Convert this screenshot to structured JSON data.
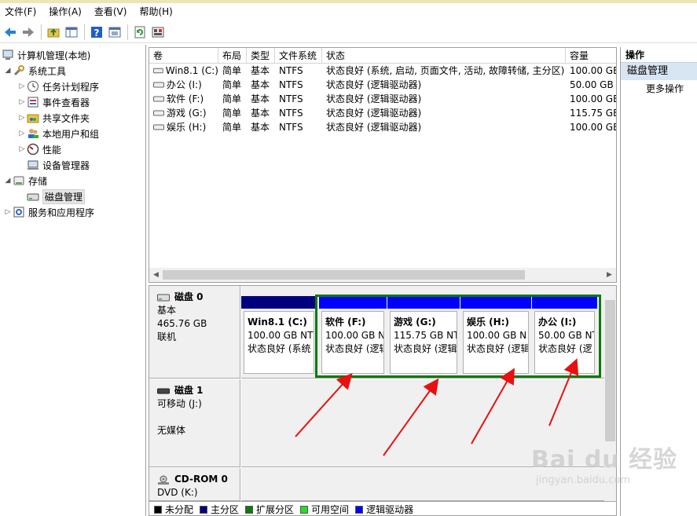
{
  "menu": [
    "文件(F)",
    "操作(A)",
    "查看(V)",
    "帮助(H)"
  ],
  "tree": {
    "root": "计算机管理(本地)",
    "system_tools": "系统工具",
    "task_scheduler": "任务计划程序",
    "event_viewer": "事件查看器",
    "shared_folders": "共享文件夹",
    "local_users": "本地用户和组",
    "performance": "性能",
    "device_manager": "设备管理器",
    "storage": "存储",
    "disk_management": "磁盘管理",
    "services_apps": "服务和应用程序"
  },
  "volume_table": {
    "columns": [
      "卷",
      "布局",
      "类型",
      "文件系统",
      "状态",
      "容量"
    ],
    "rows": [
      {
        "vol": "Win8.1 (C:)",
        "layout": "简单",
        "type": "基本",
        "fs": "NTFS",
        "status": "状态良好 (系统, 启动, 页面文件, 活动, 故障转储, 主分区)",
        "capacity": "100.00 GB"
      },
      {
        "vol": "办公 (I:)",
        "layout": "简单",
        "type": "基本",
        "fs": "NTFS",
        "status": "状态良好 (逻辑驱动器)",
        "capacity": "50.00 GB"
      },
      {
        "vol": "软件 (F:)",
        "layout": "简单",
        "type": "基本",
        "fs": "NTFS",
        "status": "状态良好 (逻辑驱动器)",
        "capacity": "100.00 GB"
      },
      {
        "vol": "游戏 (G:)",
        "layout": "简单",
        "type": "基本",
        "fs": "NTFS",
        "status": "状态良好 (逻辑驱动器)",
        "capacity": "115.75 GB"
      },
      {
        "vol": "娱乐 (H:)",
        "layout": "简单",
        "type": "基本",
        "fs": "NTFS",
        "status": "状态良好 (逻辑驱动器)",
        "capacity": "100.00 GB"
      }
    ]
  },
  "disks": [
    {
      "name": "磁盘 0",
      "kind": "基本",
      "size": "465.76 GB",
      "state": "联机",
      "partitions": [
        {
          "name": "Win8.1  (C:)",
          "size": "100.00 GB NT",
          "status": "状态良好 (系统"
        },
        {
          "name": "软件  (F:)",
          "size": "100.00 GB N",
          "status": "状态良好 (逻辑"
        },
        {
          "name": "游戏  (G:)",
          "size": "115.75 GB NT",
          "status": "状态良好 (逻辑"
        },
        {
          "name": "娱乐  (H:)",
          "size": "100.00 GB N",
          "status": "状态良好 (逻辑"
        },
        {
          "name": "办公  (I:)",
          "size": "50.00 GB NT",
          "status": "状态良好 (逻"
        }
      ]
    },
    {
      "name": "磁盘 1",
      "kind": "可移动 (J:)",
      "state": "无媒体"
    },
    {
      "name": "CD-ROM 0",
      "kind": "DVD (K:)"
    }
  ],
  "legend": [
    {
      "label": "未分配",
      "color": "#000000"
    },
    {
      "label": "主分区",
      "color": "#000080"
    },
    {
      "label": "扩展分区",
      "color": "#0b7a0b"
    },
    {
      "label": "可用空间",
      "color": "#22e022"
    },
    {
      "label": "逻辑驱动器",
      "color": "#0000ff"
    }
  ],
  "actions": {
    "header": "操作",
    "section": "磁盘管理",
    "more": "更多操作"
  },
  "colors": {
    "primary_bar": "#00007f",
    "logical_bar": "#0000ff",
    "extended_border": "#0b7a0b",
    "annotation_arrow": "#e81010"
  },
  "watermark": {
    "logo": "Bai du 经验",
    "url": "jingyan.baidu.com"
  }
}
